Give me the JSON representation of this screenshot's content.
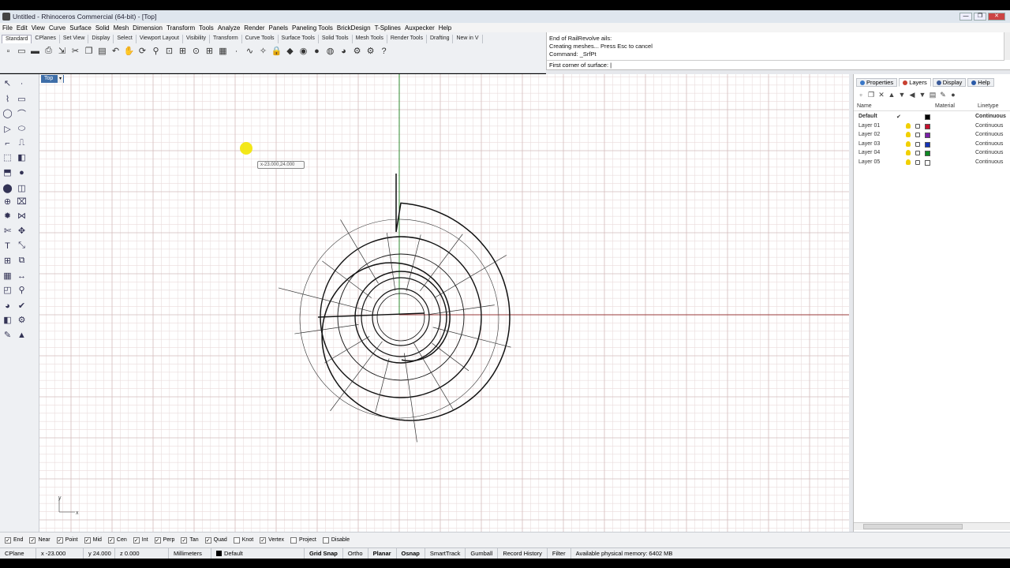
{
  "window": {
    "title": "Untitled - Rhinoceros Commercial (64-bit) - [Top]",
    "buttons": [
      "—",
      "❐",
      "✕"
    ]
  },
  "menu": [
    "File",
    "Edit",
    "View",
    "Curve",
    "Surface",
    "Solid",
    "Mesh",
    "Dimension",
    "Transform",
    "Tools",
    "Analyze",
    "Render",
    "Panels",
    "Paneling Tools",
    "BrickDesign",
    "T-Splines",
    "Auxpecker",
    "Help"
  ],
  "toolbar_tabs": [
    "Standard",
    "CPlanes",
    "Set View",
    "Display",
    "Select",
    "Viewport Layout",
    "Visibility",
    "Transform",
    "Curve Tools",
    "Surface Tools",
    "Solid Tools",
    "Mesh Tools",
    "Render Tools",
    "Drafting",
    "New in V"
  ],
  "toolbar_icons": [
    "new-icon",
    "open-icon",
    "save-icon",
    "print-icon",
    "import-icon",
    "cut-icon",
    "copy-icon",
    "paste-icon",
    "undo-icon",
    "pan-icon",
    "rotate-view-icon",
    "zoom-icon",
    "zoom-window-icon",
    "zoom-extents-icon",
    "zoom-selected-icon",
    "4-viewports-icon",
    "grid-icon",
    "points-icon",
    "curve-icon",
    "light-icon",
    "lock-icon",
    "shade-icon",
    "color-wheel-icon",
    "sphere-icon",
    "render-icon",
    "globe-icon",
    "options-icon",
    "gear-icon",
    "help-icon"
  ],
  "command": {
    "history": [
      "End of RailRevolve ails:",
      "Creating meshes... Press Esc to cancel",
      "Command: _SrfPt"
    ],
    "prompt": "First corner of surface:"
  },
  "viewport": {
    "name": "Top",
    "tooltip": "x-23.000,24.000",
    "axis_x": "x",
    "axis_y": "y"
  },
  "panel": {
    "tabs": [
      {
        "label": "Properties",
        "color": "#3a78c8"
      },
      {
        "label": "Layers",
        "color": "#c84030"
      },
      {
        "label": "Display",
        "color": "#3a5a9a"
      },
      {
        "label": "Help",
        "color": "#2a5aa8"
      }
    ],
    "columns": {
      "name": "Name",
      "material": "Material",
      "linetype": "Linetype"
    },
    "layers": [
      {
        "name": "Default",
        "check": "✔",
        "color": "#000000",
        "linetype": "Continuous",
        "current": true
      },
      {
        "name": "Layer 01",
        "check": "",
        "color": "#c8102e",
        "linetype": "Continuous",
        "current": false
      },
      {
        "name": "Layer 02",
        "check": "",
        "color": "#7a1fa8",
        "linetype": "Continuous",
        "current": false
      },
      {
        "name": "Layer 03",
        "check": "",
        "color": "#1533b8",
        "linetype": "Continuous",
        "current": false
      },
      {
        "name": "Layer 04",
        "check": "",
        "color": "#0e8a23",
        "linetype": "Continuous",
        "current": false
      },
      {
        "name": "Layer 05",
        "check": "",
        "color": "#ffffff",
        "linetype": "Continuous",
        "current": false
      }
    ]
  },
  "osnaps": [
    {
      "label": "End",
      "on": true
    },
    {
      "label": "Near",
      "on": true
    },
    {
      "label": "Point",
      "on": true
    },
    {
      "label": "Mid",
      "on": true
    },
    {
      "label": "Cen",
      "on": true
    },
    {
      "label": "Int",
      "on": true
    },
    {
      "label": "Perp",
      "on": true
    },
    {
      "label": "Tan",
      "on": true
    },
    {
      "label": "Quad",
      "on": true
    },
    {
      "label": "Knot",
      "on": false
    },
    {
      "label": "Vertex",
      "on": true
    },
    {
      "label": "Project",
      "on": false
    },
    {
      "label": "Disable",
      "on": false
    }
  ],
  "status": {
    "cplane": "CPlane",
    "x": "x -23.000",
    "y": "y 24.000",
    "z": "z 0.000",
    "units": "Millimeters",
    "layer": "Default",
    "toggles": [
      {
        "label": "Grid Snap",
        "bold": true
      },
      {
        "label": "Ortho",
        "bold": false
      },
      {
        "label": "Planar",
        "bold": true
      },
      {
        "label": "Osnap",
        "bold": true
      },
      {
        "label": "SmartTrack",
        "bold": false
      },
      {
        "label": "Gumball",
        "bold": false
      },
      {
        "label": "Record History",
        "bold": false
      },
      {
        "label": "Filter",
        "bold": false
      }
    ],
    "memory": "Available physical memory: 6402 MB"
  }
}
